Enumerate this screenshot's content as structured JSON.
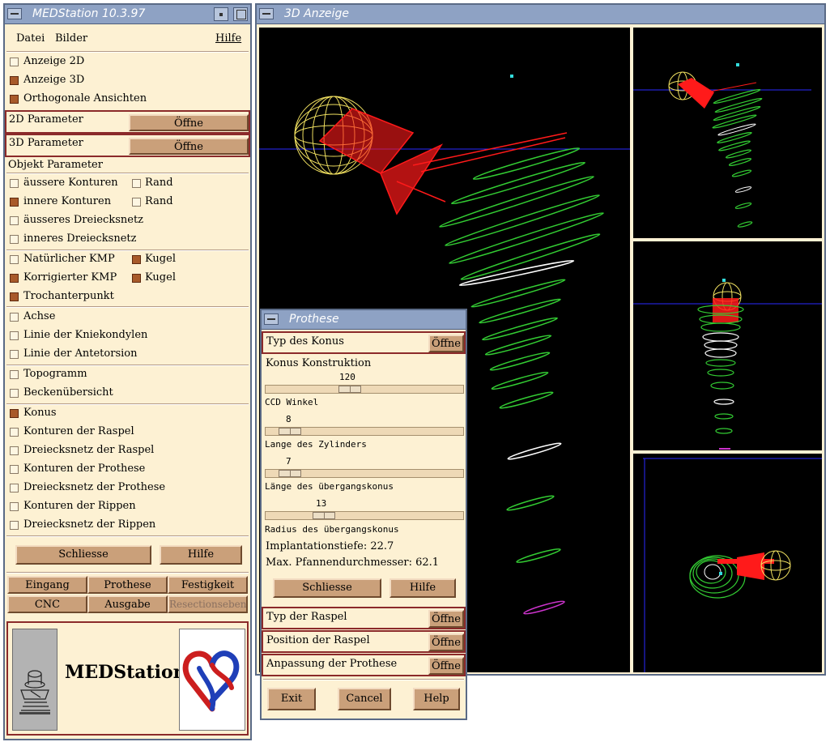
{
  "main_window": {
    "title": "MEDStation 10.3.97",
    "menu": {
      "datei": "Datei",
      "bilder": "Bilder",
      "hilfe": "Hilfe"
    },
    "display": [
      {
        "label": "Anzeige 2D",
        "checked": false
      },
      {
        "label": "Anzeige 3D",
        "checked": true
      },
      {
        "label": "Orthogonale Ansichten",
        "checked": true
      }
    ],
    "param2d": {
      "label": "2D Parameter",
      "button": "Öffne"
    },
    "param3d": {
      "label": "3D Parameter",
      "button": "Öffne"
    },
    "objekt_title": "Objekt Parameter",
    "kont": [
      {
        "label": "äussere Konturen",
        "checked": false,
        "rand_label": "Rand",
        "rand_checked": false
      },
      {
        "label": "innere Konturen",
        "checked": true,
        "rand_label": "Rand",
        "rand_checked": false
      }
    ],
    "netz": [
      {
        "label": "äusseres Dreiecksnetz",
        "checked": false
      },
      {
        "label": "inneres Dreiecksnetz",
        "checked": false
      }
    ],
    "kmp": [
      {
        "label": "Natürlicher KMP",
        "checked": false,
        "kugel_label": "Kugel",
        "kugel_checked": true
      },
      {
        "label": "Korrigierter KMP",
        "checked": true,
        "kugel_label": "Kugel",
        "kugel_checked": true
      }
    ],
    "trochanter": {
      "label": "Trochanterpunkt",
      "checked": true
    },
    "achse": [
      {
        "label": "Achse",
        "checked": false
      },
      {
        "label": "Linie der Kniekondylen",
        "checked": false
      },
      {
        "label": "Linie der Antetorsion",
        "checked": false
      }
    ],
    "topo": [
      {
        "label": "Topogramm",
        "checked": false
      },
      {
        "label": "Beckenübersicht",
        "checked": false
      }
    ],
    "konus": [
      {
        "label": "Konus",
        "checked": true
      },
      {
        "label": "Konturen der Raspel",
        "checked": false
      },
      {
        "label": "Dreiecksnetz der Raspel",
        "checked": false
      },
      {
        "label": "Konturen der Prothese",
        "checked": false
      },
      {
        "label": "Dreiecksnetz der Prothese",
        "checked": false
      },
      {
        "label": "Konturen der Rippen",
        "checked": false
      },
      {
        "label": "Dreiecksnetz der Rippen",
        "checked": false
      }
    ],
    "schliesse": "Schliesse",
    "hilfe_btn": "Hilfe",
    "modules": {
      "eingang": "Eingang",
      "prothese": "Prothese",
      "festigkeit": "Festigkeit",
      "cnc": "CNC",
      "ausgabe": "Ausgabe",
      "resektion": "Resectionsebene"
    },
    "brand": "MEDStation"
  },
  "anzeige_window": {
    "title": "3D Anzeige"
  },
  "prothese_window": {
    "title": "Prothese",
    "typ_konus": {
      "label": "Typ des Konus",
      "button": "Öffne"
    },
    "konstruktion": "Konus Konstruktion",
    "sliders": [
      {
        "label": "CCD Winkel",
        "value": "8",
        "fraction": 0.03
      },
      {
        "label": "Lange des Zylinders",
        "value": "7",
        "fraction": 0.03
      },
      {
        "label": "Länge des übergangskonus",
        "value": "13",
        "fraction": 0.22
      },
      {
        "label": "Radius des übergangskonus",
        "value": "",
        "fraction": 0
      }
    ],
    "top_value": "120",
    "top_fraction": 0.43,
    "implantationstiefe": "Implantationstiefe: 22.7",
    "pfannen": "Max. Pfannendurchmesser: 62.1",
    "schliesse": "Schliesse",
    "hilfe": "Hilfe",
    "typ_raspel": {
      "label": "Typ der Raspel",
      "button": "Öffne"
    },
    "pos_raspel": {
      "label": "Position der Raspel",
      "button": "Öffne"
    },
    "anpassung": {
      "label": "Anpassung der Prothese",
      "button": "Öffne"
    },
    "exit": "Exit",
    "cancel": "Cancel",
    "help": "Help"
  },
  "colors": {
    "panel_bg": "#fdf1d3",
    "titlebar": "#8ea2c4",
    "button": "#caa07a",
    "checked": "#a85a2a",
    "frame_red": "#8b2a2a",
    "viewport_bg": "#000000",
    "sphere": "#f0e060",
    "cone": "#ff1a1a",
    "contour": "#33cc33"
  }
}
